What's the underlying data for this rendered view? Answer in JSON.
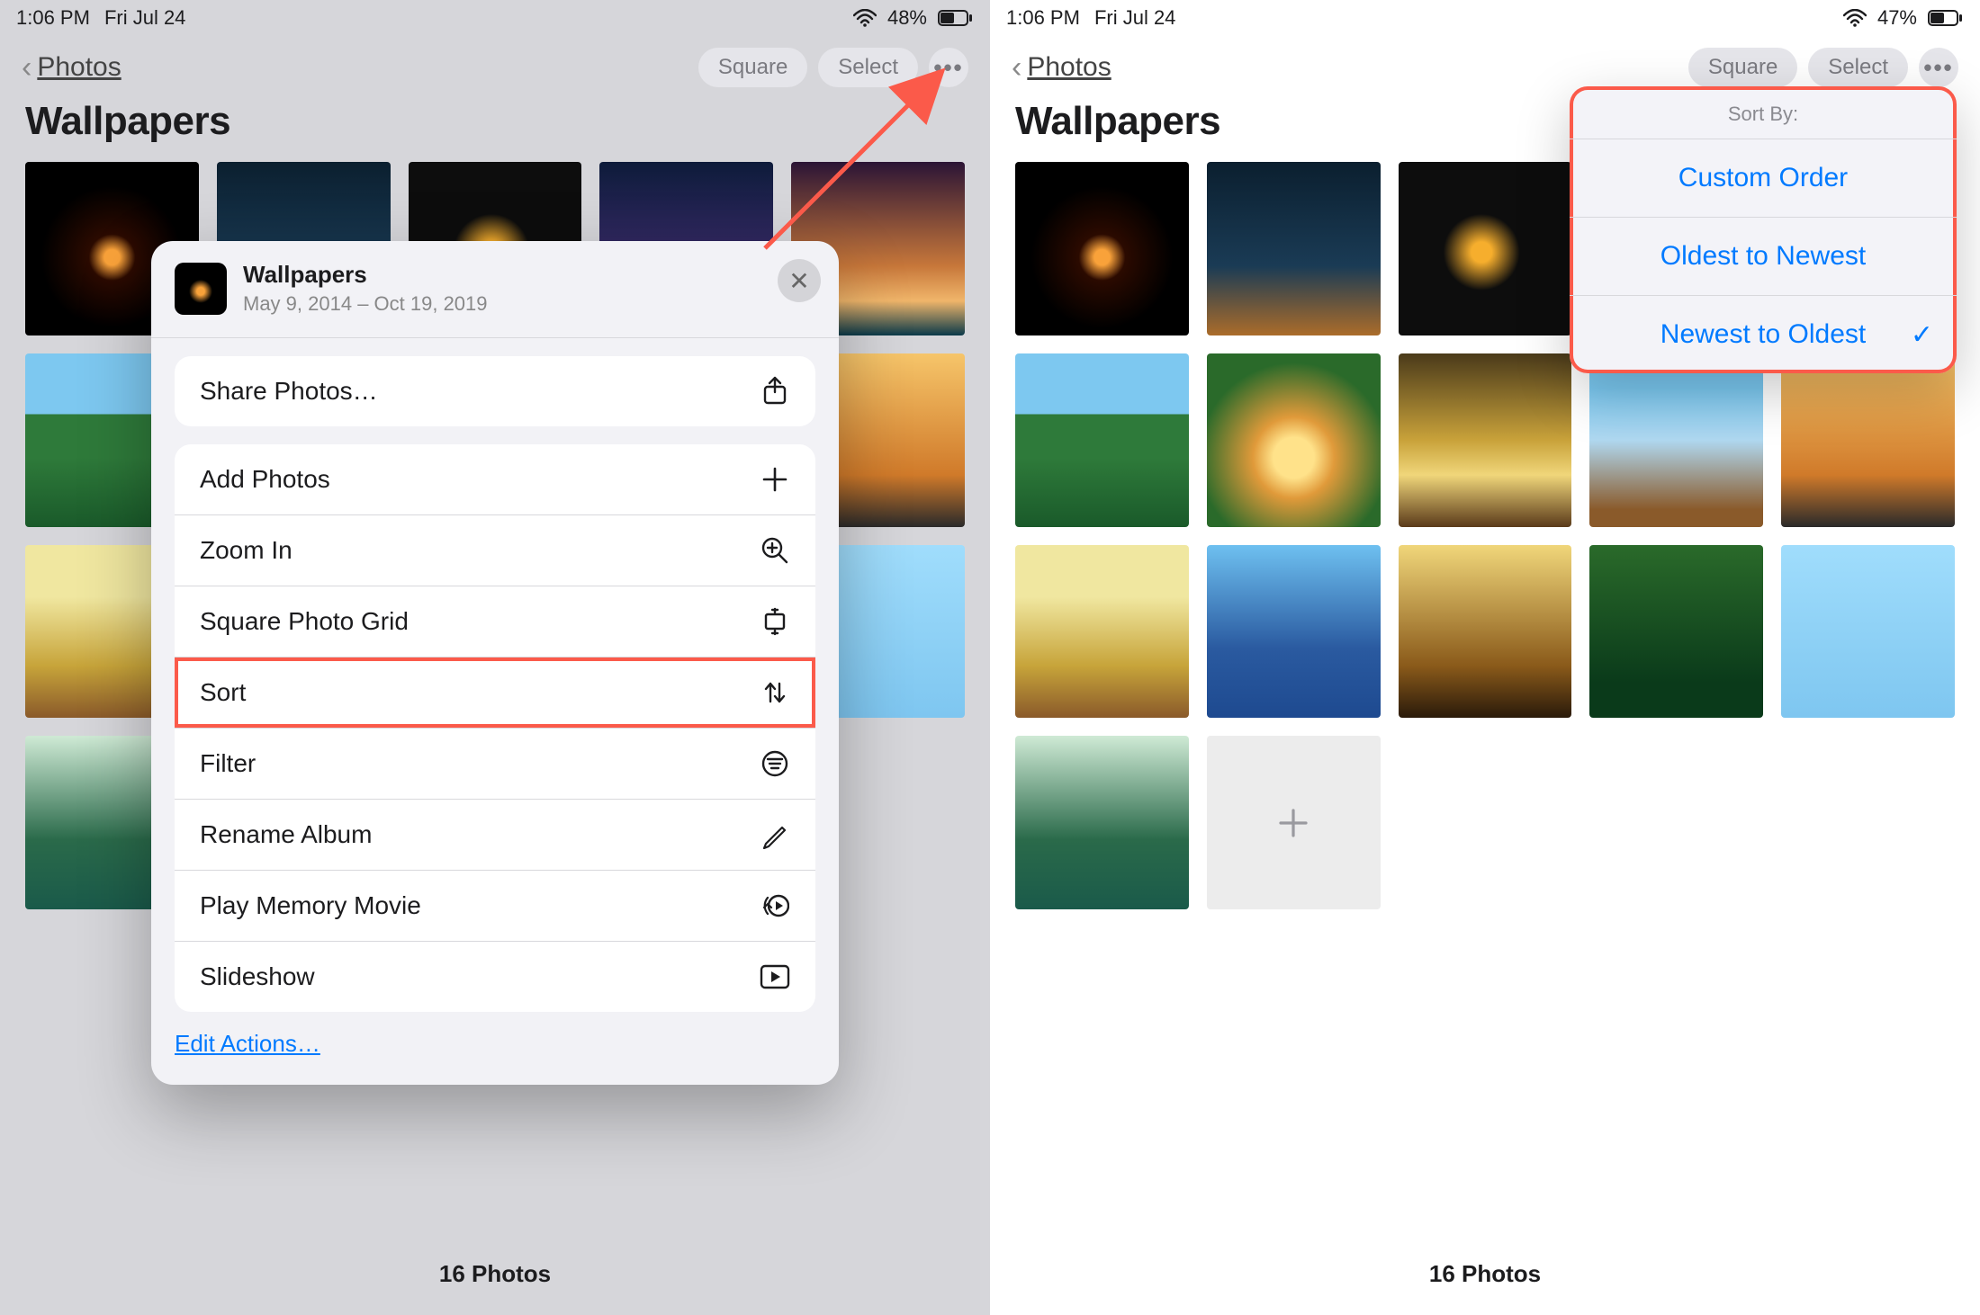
{
  "left": {
    "status": {
      "time": "1:06 PM",
      "date": "Fri Jul 24",
      "battery": "48%"
    },
    "nav": {
      "back": "Photos",
      "square": "Square",
      "select": "Select"
    },
    "title": "Wallpapers",
    "footer": "16 Photos",
    "card": {
      "title": "Wallpapers",
      "subtitle": "May 9, 2014 – Oct 19, 2019",
      "share": "Share Photos…",
      "add": "Add Photos",
      "zoom": "Zoom In",
      "square_grid": "Square Photo Grid",
      "sort": "Sort",
      "filter": "Filter",
      "rename": "Rename Album",
      "memory": "Play Memory Movie",
      "slideshow": "Slideshow",
      "edit_actions": "Edit Actions…"
    }
  },
  "right": {
    "status": {
      "time": "1:06 PM",
      "date": "Fri Jul 24",
      "battery": "47%"
    },
    "nav": {
      "back": "Photos",
      "square": "Square",
      "select": "Select"
    },
    "title": "Wallpapers",
    "footer": "16 Photos",
    "sort": {
      "header": "Sort By:",
      "custom": "Custom Order",
      "oldest": "Oldest to Newest",
      "newest": "Newest to Oldest"
    }
  }
}
